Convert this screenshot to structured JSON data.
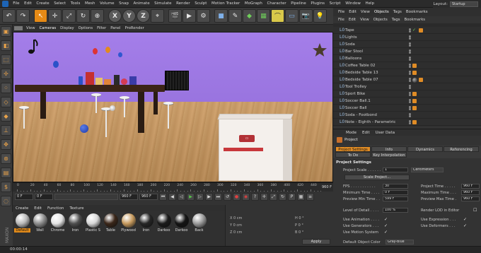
{
  "menubar": {
    "items": [
      "File",
      "Edit",
      "Create",
      "Select",
      "Tools",
      "Mesh",
      "Volume",
      "Snap",
      "Animate",
      "Simulate",
      "Render",
      "Sculpt",
      "Motion Tracker",
      "MoGraph",
      "Character",
      "Pipeline",
      "Plugins",
      "Script",
      "Window",
      "Help"
    ],
    "layout_label": "Layout:",
    "layout_value": "Startup"
  },
  "toolbar": {
    "buttons": [
      "undo-icon",
      "redo-icon",
      "live-select-icon",
      "move-icon",
      "scale-icon",
      "rotate-icon",
      "object-icon",
      "x-axis",
      "y-axis",
      "z-axis",
      "coordinate-icon",
      "render-view-icon",
      "render-picture-icon",
      "render-settings-icon",
      "cube-icon",
      "pen-icon",
      "subdivision-icon",
      "array-icon",
      "bend-icon",
      "floor-icon",
      "camera-icon",
      "light-icon"
    ],
    "x_label": "X",
    "y_label": "Y",
    "z_label": "Z"
  },
  "viewport": {
    "menu": [
      "View",
      "Cameras",
      "Display",
      "Options",
      "Filter",
      "Panel",
      "ProRender"
    ]
  },
  "timeline": {
    "ticks": [
      "0",
      "20",
      "40",
      "60",
      "80",
      "100",
      "120",
      "140",
      "160",
      "180",
      "200",
      "220",
      "240",
      "260",
      "280",
      "300",
      "320",
      "340",
      "360",
      "380",
      "400",
      "420",
      "440"
    ],
    "end_label": "960 F"
  },
  "transport": {
    "start": "0 F",
    "current": "0 F",
    "end_a": "960 F",
    "end_b": "960 F",
    "fps_field": "5"
  },
  "materials": {
    "menu": [
      "Create",
      "Edit",
      "Function",
      "Texture"
    ],
    "items": [
      {
        "label": "Default",
        "color": "#b9b9b9",
        "selected": true
      },
      {
        "label": "Wall",
        "color": "#8c8c8c",
        "selected": false
      },
      {
        "label": "Chrome",
        "color": "#e4e4e4",
        "selected": false
      },
      {
        "label": "Iron",
        "color": "#4f4f4f",
        "selected": false
      },
      {
        "label": "Plastic S",
        "color": "#d8d8d8",
        "selected": false
      },
      {
        "label": "Table",
        "color": "#3a2619",
        "selected": false
      },
      {
        "label": "Plywood",
        "color": "#c69a5e",
        "selected": false
      },
      {
        "label": "Iron",
        "color": "#262626",
        "selected": false
      },
      {
        "label": "Darkoo",
        "color": "#1b1b1b",
        "selected": false
      },
      {
        "label": "Darkoo",
        "color": "#141414",
        "selected": false
      },
      {
        "label": "Back",
        "color": "#9a9a9a",
        "selected": false
      }
    ],
    "row2_colors": [
      "#a4a4a4",
      "#dedede",
      "#cfcfcf",
      "#3a3a3a",
      "#9a9a9a",
      "#b22a2a",
      "#e4e4e4",
      "#2c2c2c",
      "#cfcfcf",
      "#2a2a2a",
      "#bcbcbc"
    ]
  },
  "coords": {
    "x": "X  0 cm",
    "y": "Y  0 cm",
    "z": "Z  0 cm",
    "h": "H  0 °",
    "p": "P  0 °",
    "b": "B  0 °",
    "apply": "Apply"
  },
  "status": {
    "time": "00:00:14"
  },
  "objects": {
    "tabs": [
      "File",
      "Edit",
      "View",
      "Objects",
      "Tags",
      "Bookmarks"
    ],
    "active_tab": "Objects",
    "menu": [
      "File",
      "Edit",
      "View",
      "Objects",
      "Tags",
      "Bookmarks"
    ],
    "rows": [
      {
        "name": "Tape",
        "tag": "check-orange"
      },
      {
        "name": "Lights",
        "tag": "none"
      },
      {
        "name": "Soda",
        "tag": "none"
      },
      {
        "name": "Bar Stool",
        "tag": "none"
      },
      {
        "name": "Balloons",
        "tag": "none"
      },
      {
        "name": "Coffee Table 02",
        "tag": "orange"
      },
      {
        "name": "Bedside Table 13",
        "tag": "orange"
      },
      {
        "name": "Bedside Table 07",
        "tag": "sphere-orange"
      },
      {
        "name": "Tool Trolley",
        "tag": "none"
      },
      {
        "name": "Sport Bike",
        "tag": "orange"
      },
      {
        "name": "Soccer Ball.1",
        "tag": "orange"
      },
      {
        "name": "Soccer Ball",
        "tag": "orange"
      },
      {
        "name": "Soda - Footbond",
        "tag": "none"
      },
      {
        "name": "Note - Eighth - Parametric",
        "tag": "orange"
      }
    ]
  },
  "attributes": {
    "menu": [
      "Mode",
      "Edit",
      "User Data"
    ],
    "title": "Project",
    "tabs": [
      "Project Settings",
      "Info",
      "Dynamics",
      "Referencing",
      "To Do",
      "Key Interpolation"
    ],
    "section": "Project Settings",
    "project_scale_label": "Project Scale . . . . . .",
    "project_scale_value": "1",
    "project_scale_unit": "Centimeters",
    "scale_button": "Scale Project...",
    "fps_label": "FPS . . . . . . . . . . .",
    "fps_value": "30",
    "project_time_label": "Project Time . . . . .",
    "project_time_value": "960 F",
    "min_time_label": "Minimum Time . . . .",
    "min_time_value": "0 F",
    "max_time_label": "Maximum Time . . .",
    "max_time_value": "960 F",
    "prev_min_label": "Preview Min Time . .",
    "prev_min_value": "599 F",
    "prev_max_label": "Preview Max Time .",
    "prev_max_value": "960 F",
    "lod_label": "Level of Detail . . . .",
    "lod_value": "100 %",
    "render_lod_label": "Render LOD in Editor",
    "use_animation": "Use Animation . . . .",
    "use_expression": "Use Expression . . .",
    "use_generators": "Use Generators . . .",
    "use_deformers": "Use Deformers . . .",
    "use_motion": "Use Motion System",
    "default_color_label": "Default Object Color",
    "default_color_value": "Gray-Blue"
  },
  "colors": {
    "accent": "#e08c25",
    "wall": "#a47ee9"
  }
}
